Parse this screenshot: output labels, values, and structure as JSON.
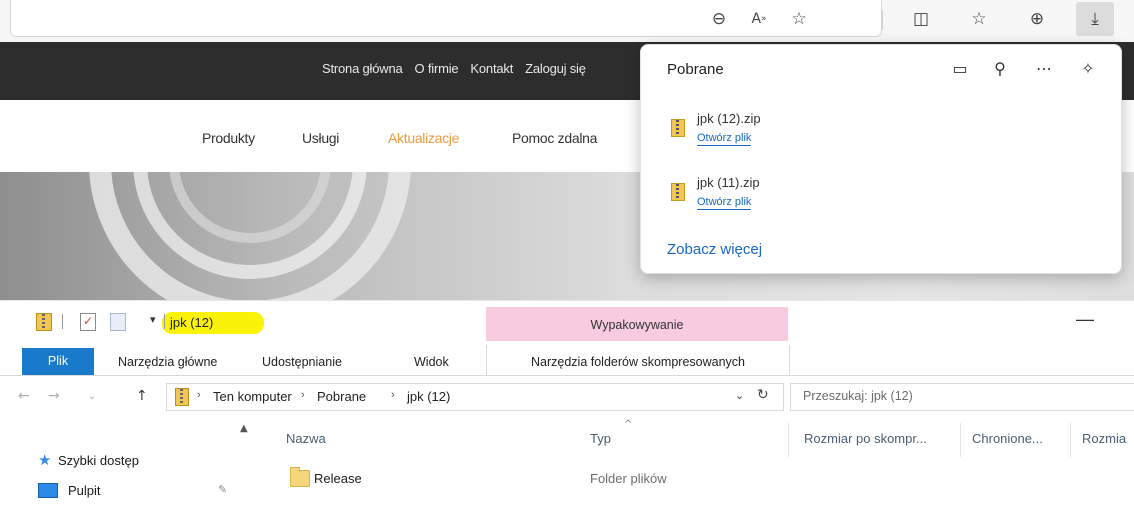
{
  "browser": {
    "toolbar_icons": [
      "zoom-out-icon",
      "read-aloud-icon",
      "favorite-star-icon",
      "split-screen-icon",
      "favorites-list-icon",
      "collections-icon",
      "download-icon"
    ]
  },
  "website": {
    "top_nav": [
      "Strona główna",
      "O firmie",
      "Kontakt",
      "Zaloguj się"
    ],
    "main_nav": [
      "Produkty",
      "Usługi",
      "Aktualizacje",
      "Pomoc zdalna"
    ],
    "active_item": "Aktualizacje",
    "accent_color": "#e89a3c"
  },
  "downloads_panel": {
    "title": "Pobrane",
    "items": [
      {
        "name": "jpk (12).zip",
        "action": "Otwórz plik"
      },
      {
        "name": "jpk (11).zip",
        "action": "Otwórz plik"
      }
    ],
    "see_more": "Zobacz więcej",
    "link_color": "#1a66c4"
  },
  "explorer": {
    "title": "jpk (12)",
    "contextual_tab": "Wypakowywanie",
    "ribbon_tabs": [
      "Plik",
      "Narzędzia główne",
      "Udostępnianie",
      "Widok",
      "Narzędzia folderów skompresowanych"
    ],
    "breadcrumb": [
      "Ten komputer",
      "Pobrane",
      "jpk (12)"
    ],
    "search_placeholder": "Przeszukaj: jpk (12)",
    "nav_pane": [
      "Szybki dostęp",
      "Pulpit"
    ],
    "columns": [
      "Nazwa",
      "Typ",
      "Rozmiar po skompr...",
      "Chronione...",
      "Rozmia"
    ],
    "rows": [
      {
        "name": "Release",
        "type": "Folder plików"
      }
    ],
    "highlight_color": "#fbf20a",
    "ribbon_accent": "#1979ca"
  }
}
